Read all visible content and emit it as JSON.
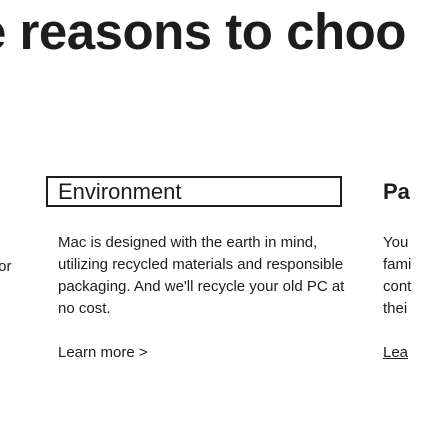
{
  "headline": "e reasons to choo",
  "left_fragment": "for",
  "card": {
    "title": "Environment",
    "body": "Mac is designed with the earth in mind, utilizing recycled materials and responsible packaging. And we'll recycle your old PC at no cost.",
    "link": "Learn more >"
  },
  "right_card": {
    "title": "Pa",
    "lines": [
      "You",
      "fami",
      "cont",
      "thei"
    ],
    "link": "Lea"
  }
}
